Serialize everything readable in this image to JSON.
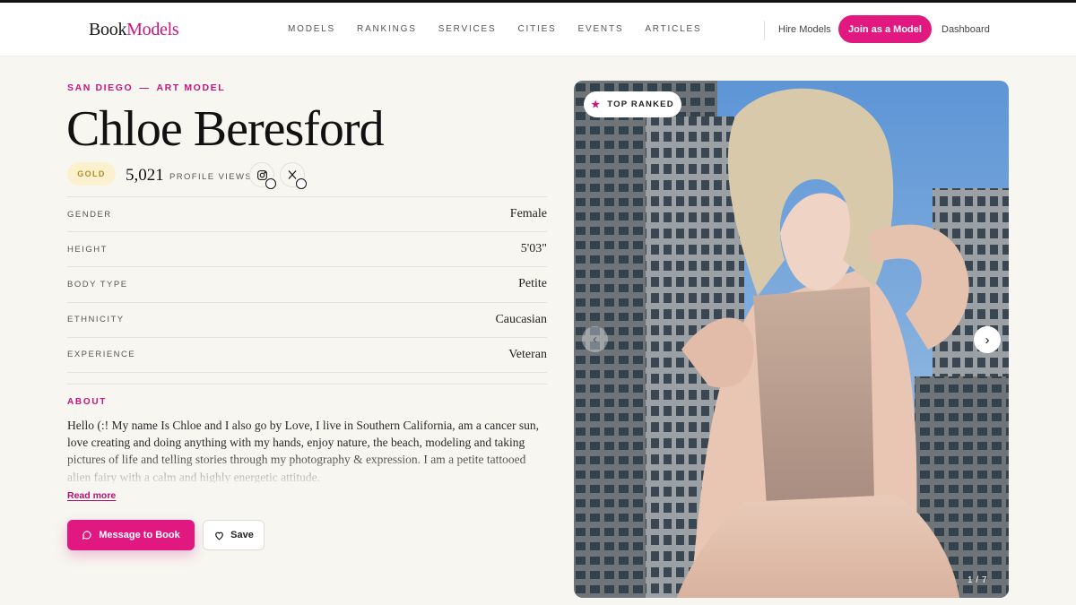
{
  "brand": {
    "part1": "Book",
    "part2": "Models"
  },
  "nav": [
    "MODELS",
    "RANKINGS",
    "SERVICES",
    "CITIES",
    "EVENTS",
    "ARTICLES"
  ],
  "header_actions": {
    "hire": "Hire Models",
    "join": "Join as a Model",
    "dashboard": "Dashboard"
  },
  "profile": {
    "city": "SAN DIEGO",
    "sep": "—",
    "category": "ART MODEL",
    "name": "Chloe Beresford",
    "tier": "GOLD",
    "views": "5,021",
    "views_label": "PROFILE VIEWS",
    "attributes": [
      {
        "label": "GENDER",
        "value": "Female"
      },
      {
        "label": "HEIGHT",
        "value": "5'03\""
      },
      {
        "label": "BODY TYPE",
        "value": "Petite"
      },
      {
        "label": "ETHNICITY",
        "value": "Caucasian"
      },
      {
        "label": "EXPERIENCE",
        "value": "Veteran"
      }
    ],
    "about_heading": "ABOUT",
    "about": "Hello (:! My name Is Chloe and I also go by Love, I live in Southern California, am a cancer sun, love creating and doing anything with my hands, enjoy nature, the beach, modeling and taking pictures of life and telling stories through my photography & expression. I am a petite tattooed alien fairy with a calm and highly energetic attitude.",
    "read_more": "Read more",
    "message_button": "Message to Book",
    "save_button": "Save"
  },
  "gallery": {
    "badge": "TOP RANKED",
    "counter": "1 / 7"
  },
  "colors": {
    "accent": "#e0187f",
    "accent_text": "#c9157d",
    "gold_bg": "#fbf1cf",
    "page_bg": "#f7f6f1"
  },
  "icons": [
    "instagram-icon",
    "x-icon",
    "chat-bubble-icon",
    "heart-icon",
    "star-icon",
    "chevron-left-icon",
    "chevron-right-icon"
  ]
}
